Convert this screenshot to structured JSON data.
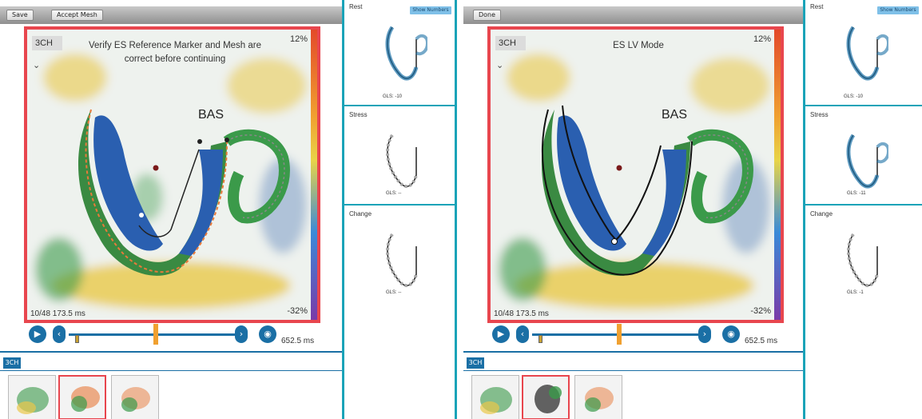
{
  "left": {
    "toolbar": {
      "button1": "Save",
      "button2": "Accept Mesh"
    },
    "view_select": "3CH",
    "message": "Verify ES Reference Marker and Mesh are correct before continuing",
    "bas_label": "BAS",
    "scale_top": "12%",
    "scale_bottom": "-32%",
    "frame_info": "10/48  173.5 ms",
    "time": "652.5 ms",
    "strip_tab": "3CH"
  },
  "right": {
    "toolbar": {
      "button1": "Done"
    },
    "view_select": "3CH",
    "mode_title": "ES LV Mode",
    "bas_label": "BAS",
    "scale_top": "12%",
    "scale_bottom": "-32%",
    "frame_info": "10/48  173.5 ms",
    "time": "652.5 ms",
    "strip_tab": "3CH"
  },
  "sidebar_left": {
    "sections": [
      {
        "label": "Rest",
        "button": "Show Numbers",
        "caption": "GLS: -10"
      },
      {
        "label": "Stress",
        "caption": "GLS: --"
      },
      {
        "label": "Change",
        "caption": "GLS: --"
      }
    ]
  },
  "sidebar_right": {
    "sections": [
      {
        "label": "Rest",
        "button": "Show Numbers",
        "caption": "GLS: -10"
      },
      {
        "label": "Stress",
        "caption": "GLS: -11"
      },
      {
        "label": "Change",
        "caption": "GLS: -1"
      }
    ]
  },
  "colors": {
    "accent": "#1a6fa5",
    "frame": "#e8464e",
    "teal": "#1aa3b8"
  }
}
